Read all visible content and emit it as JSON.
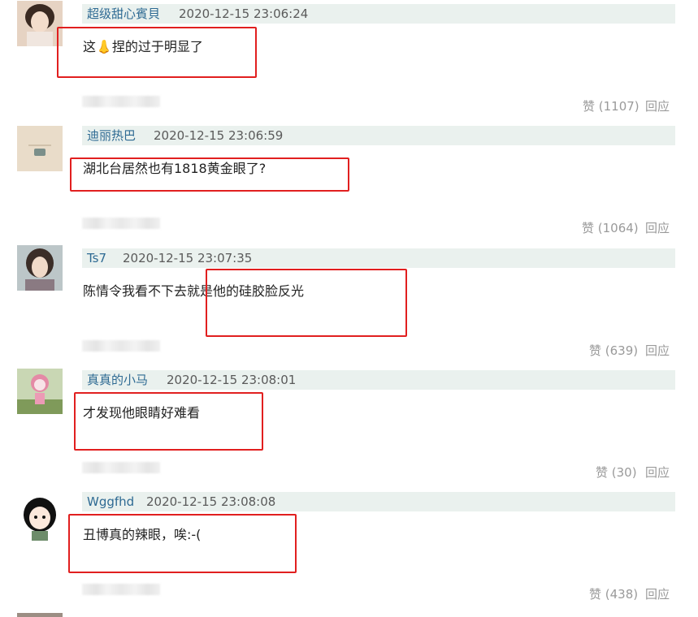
{
  "comments": [
    {
      "username": "超级甜心賓貝",
      "timestamp": "2020-12-15 23:06:24",
      "text": "这👃捏的过于明显了",
      "likes": "赞 (1107)",
      "reply": "回应"
    },
    {
      "username": "迪丽热巴",
      "timestamp": "2020-12-15 23:06:59",
      "text": "湖北台居然也有1818黄金眼了?",
      "likes": "赞 (1064)",
      "reply": "回应"
    },
    {
      "username": "Ts7",
      "timestamp": "2020-12-15 23:07:35",
      "text": "陈情令我看不下去就是他的硅胶脸反光",
      "likes": "赞 (639)",
      "reply": "回应"
    },
    {
      "username": "真真的小马",
      "timestamp": "2020-12-15 23:08:01",
      "text": "才发现他眼睛好难看",
      "likes": "赞 (30)",
      "reply": "回应"
    },
    {
      "username": "Wggfhd",
      "timestamp": "2020-12-15 23:08:08",
      "text": "丑博真的辣眼，唉:-(",
      "likes": "赞 (438)",
      "reply": "回应"
    }
  ],
  "colors": {
    "username": "#2e6a93",
    "header_bar": "#eaf1ee",
    "highlight_box": "#e11f1f",
    "meta_gray": "#9a9a9a"
  }
}
